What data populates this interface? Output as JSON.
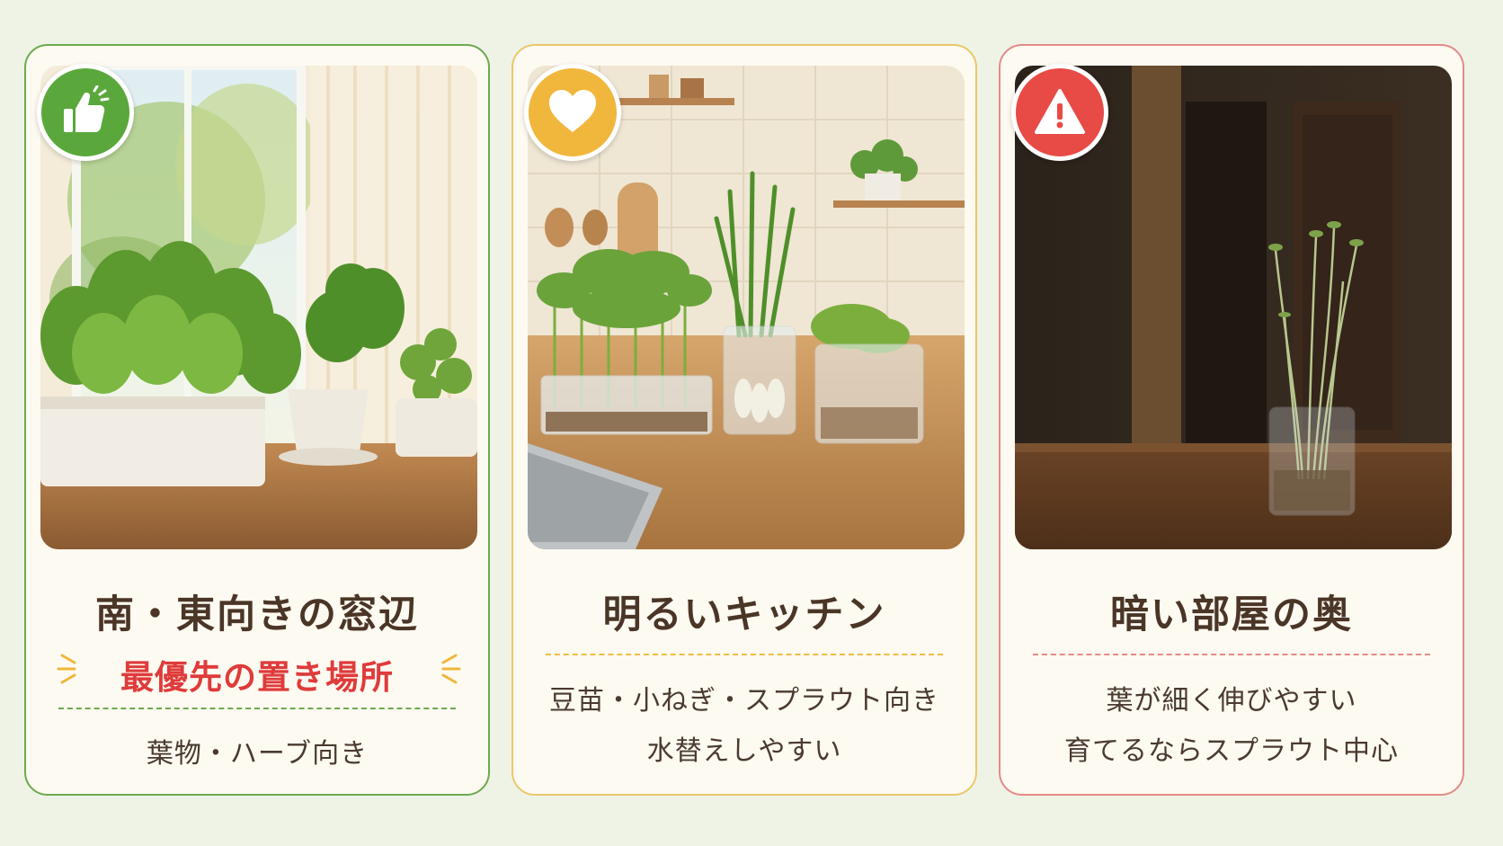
{
  "cards": [
    {
      "title": "南・東向きの窓辺",
      "priority": "最優先の置き場所",
      "lines": [
        "葉物・ハーブ向き"
      ],
      "badge_icon": "thumbs-up-icon",
      "accent": "#6ea94e"
    },
    {
      "title": "明るいキッチン",
      "lines": [
        "豆苗・小ねぎ・スプラウト向き",
        "水替えしやすい"
      ],
      "badge_icon": "heart-icon",
      "accent": "#ebc76a"
    },
    {
      "title": "暗い部屋の奥",
      "lines": [
        "葉が細く伸びやすい",
        "育てるならスプラウト中心"
      ],
      "badge_icon": "warning-icon",
      "accent": "#e58a86"
    }
  ],
  "colors": {
    "background": "#eef3e6",
    "card_background": "#fdfaf1",
    "title_text": "#4a3527",
    "priority_text": "#df3b3b",
    "badge_green": "#5aa83b",
    "badge_yellow": "#f0b73c",
    "badge_red": "#e84a45",
    "divider_green": "#6ea94e",
    "divider_yellow": "#edbd45",
    "divider_red": "#e58a86"
  }
}
